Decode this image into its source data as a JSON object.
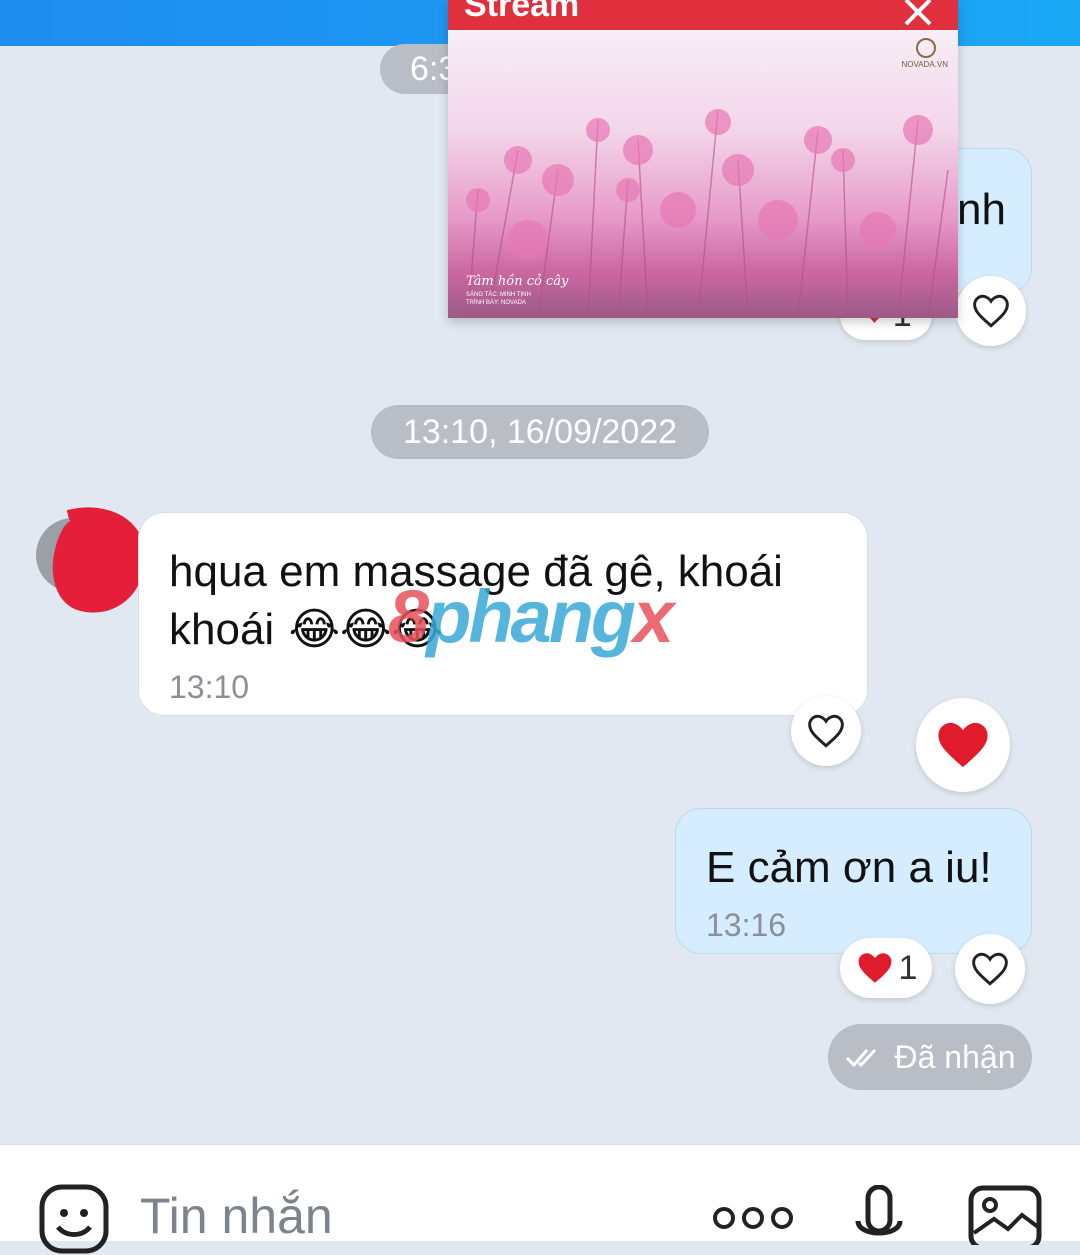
{
  "top_bar": {
    "color": "#1f8cf0"
  },
  "time_pill_top": {
    "text": "6:3"
  },
  "stream_popup": {
    "title": "Stream",
    "watermark_brand": "NOVADA.VN",
    "caption_script": "Tâm hồn cỏ cây",
    "caption_lines": [
      "SÁNG TÁC: MINH TỊNH",
      "TRÌNH BÀY: NOVADA"
    ]
  },
  "partial_bubble": {
    "text_fragment": "nh",
    "reaction_count": "1"
  },
  "date_separator": "13:10, 16/09/2022",
  "incoming": {
    "line1": "hqua em massage đã gê, khoái",
    "line2": "khoái",
    "emoji": "😂😂😂",
    "time": "13:10"
  },
  "watermark": {
    "part1": "8",
    "part2": "phang",
    "part3": "x"
  },
  "outgoing": {
    "text": "E cảm ơn a iu!",
    "time": "13:16",
    "reaction_count": "1"
  },
  "status": {
    "label": "Đã nhận"
  },
  "input": {
    "placeholder": "Tin nhắn"
  },
  "colors": {
    "accent": "#1f8cf0",
    "heart": "#e0303d",
    "out_bubble": "#d6ecff"
  }
}
